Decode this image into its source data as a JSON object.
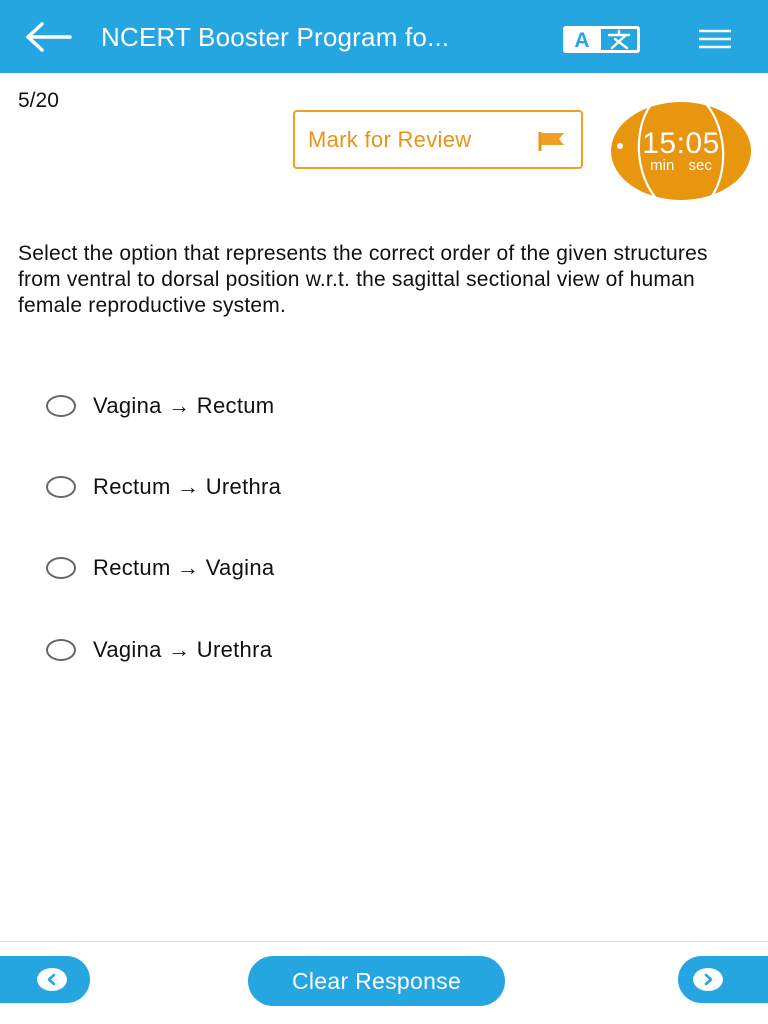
{
  "header": {
    "title": "NCERT Booster Program fo...",
    "back_icon": "arrow-left-icon",
    "lang_icon": "translate-icon",
    "lang_letter": "A",
    "menu_icon": "hamburger-menu-icon",
    "bar_color": "#26a6e0"
  },
  "question_meta": {
    "progress": "5/20",
    "mark_for_review_label": "Mark for Review",
    "flag_icon": "flag-icon",
    "accent_color": "#e8921a"
  },
  "timer": {
    "value": "15:05",
    "units": "min sec"
  },
  "question": {
    "text": "Select the option that represents the correct order of the given structures from ventral to dorsal position w.r.t. the sagittal sectional view of human female reproductive system.",
    "options": [
      {
        "label": "Vagina → Rectum"
      },
      {
        "label": "Rectum → Urethra"
      },
      {
        "label": "Rectum → Vagina"
      },
      {
        "label": "Vagina → Urethra"
      }
    ]
  },
  "footer": {
    "clear_label": "Clear Response",
    "prev_icon": "chevron-left-icon",
    "next_icon": "chevron-right-icon"
  }
}
